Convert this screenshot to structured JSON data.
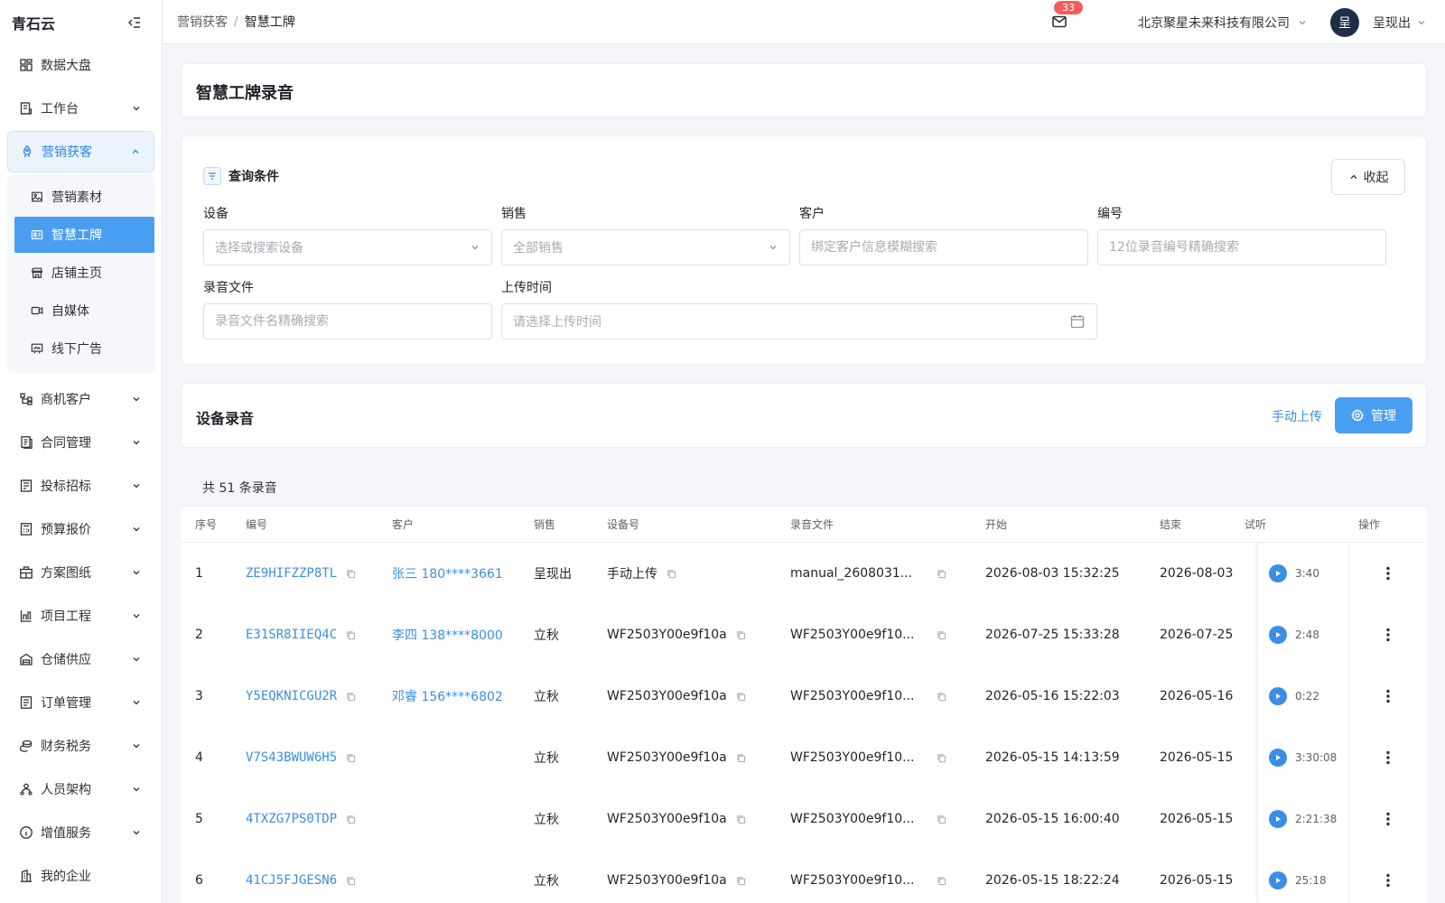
{
  "app": {
    "brand": "青石云"
  },
  "sidebar": {
    "items": [
      {
        "label": "数据大盘",
        "icon": "dashboard-icon",
        "chevron": false
      },
      {
        "label": "工作台",
        "icon": "workbench-icon",
        "chevron": true
      },
      {
        "label": "营销获客",
        "icon": "rocket-icon",
        "chevron": true,
        "open": true,
        "children": [
          {
            "label": "营销素材",
            "icon": "image-icon"
          },
          {
            "label": "智慧工牌",
            "icon": "id-card-icon",
            "active": true
          },
          {
            "label": "店铺主页",
            "icon": "store-icon"
          },
          {
            "label": "自媒体",
            "icon": "video-icon"
          },
          {
            "label": "线下广告",
            "icon": "billboard-icon"
          }
        ]
      },
      {
        "label": "商机客户",
        "icon": "org-icon",
        "chevron": true
      },
      {
        "label": "合同管理",
        "icon": "contract-icon",
        "chevron": true
      },
      {
        "label": "投标招标",
        "icon": "bid-icon",
        "chevron": true
      },
      {
        "label": "预算报价",
        "icon": "calculator-icon",
        "chevron": true
      },
      {
        "label": "方案图纸",
        "icon": "blueprint-icon",
        "chevron": true
      },
      {
        "label": "项目工程",
        "icon": "project-icon",
        "chevron": true
      },
      {
        "label": "仓储供应",
        "icon": "warehouse-icon",
        "chevron": true
      },
      {
        "label": "订单管理",
        "icon": "order-icon",
        "chevron": true
      },
      {
        "label": "财务税务",
        "icon": "finance-icon",
        "chevron": true
      },
      {
        "label": "人员架构",
        "icon": "people-icon",
        "chevron": true
      },
      {
        "label": "增值服务",
        "icon": "info-icon",
        "chevron": true
      },
      {
        "label": "我的企业",
        "icon": "company-icon",
        "chevron": false
      }
    ]
  },
  "header": {
    "breadcrumb": {
      "parent": "营销获客",
      "separator": "/",
      "current": "智慧工牌"
    },
    "mail_badge": "33",
    "company": "北京聚星未来科技有限公司",
    "avatar": "呈",
    "user": "呈现出"
  },
  "page": {
    "title": "智慧工牌录音"
  },
  "filters": {
    "title": "查询条件",
    "fold_label": "收起",
    "device": {
      "label": "设备",
      "placeholder": "选择或搜索设备"
    },
    "sales": {
      "label": "销售",
      "placeholder": "全部销售"
    },
    "customer": {
      "label": "客户",
      "placeholder": "绑定客户信息模糊搜索"
    },
    "code": {
      "label": "编号",
      "placeholder": "12位录音编号精确搜索"
    },
    "file": {
      "label": "录音文件",
      "placeholder": "录音文件名精确搜索"
    },
    "upload_time": {
      "label": "上传时间",
      "placeholder": "请选择上传时间"
    }
  },
  "recordings": {
    "title": "设备录音",
    "upload_label": "手动上传",
    "manage_label": "管理",
    "count_text": "共 51 条录音"
  },
  "table": {
    "columns": [
      "序号",
      "编号",
      "客户",
      "销售",
      "设备号",
      "录音文件",
      "开始",
      "结束",
      "试听",
      "操作"
    ],
    "rows": [
      {
        "index": "1",
        "code": "ZE9HIFZZP8TL",
        "customer": "张三 180****3661",
        "sales": "呈现出",
        "device": "手动上传",
        "file": "manual_2608031...",
        "start": "2026-08-03 15:32:25",
        "end": "2026-08-03",
        "duration": "3:40"
      },
      {
        "index": "2",
        "code": "E31SR8IIEQ4C",
        "customer": "李四 138****8000",
        "sales": "立秋",
        "device": "WF2503Y00e9f10a",
        "file": "WF2503Y00e9f10...",
        "start": "2026-07-25 15:33:28",
        "end": "2026-07-25",
        "duration": "2:48"
      },
      {
        "index": "3",
        "code": "Y5EQKNICGU2R",
        "customer": "邓睿 156****6802",
        "sales": "立秋",
        "device": "WF2503Y00e9f10a",
        "file": "WF2503Y00e9f10...",
        "start": "2026-05-16 15:22:03",
        "end": "2026-05-16",
        "duration": "0:22"
      },
      {
        "index": "4",
        "code": "V7S43BWUW6H5",
        "customer": "",
        "sales": "立秋",
        "device": "WF2503Y00e9f10a",
        "file": "WF2503Y00e9f10...",
        "start": "2026-05-15 14:13:59",
        "end": "2026-05-15",
        "duration": "3:30:08"
      },
      {
        "index": "5",
        "code": "4TXZG7PS0TDP",
        "customer": "",
        "sales": "立秋",
        "device": "WF2503Y00e9f10a",
        "file": "WF2503Y00e9f10...",
        "start": "2026-05-15 16:00:40",
        "end": "2026-05-15",
        "duration": "2:21:38"
      },
      {
        "index": "6",
        "code": "41CJ5FJGESN6",
        "customer": "",
        "sales": "立秋",
        "device": "WF2503Y00e9f10a",
        "file": "WF2503Y00e9f10...",
        "start": "2026-05-15 18:22:24",
        "end": "2026-05-15",
        "duration": "25:18"
      }
    ]
  },
  "colors": {
    "accent": "#4a9ef2",
    "link": "#3a8ee6",
    "badge": "#f05d5d"
  }
}
